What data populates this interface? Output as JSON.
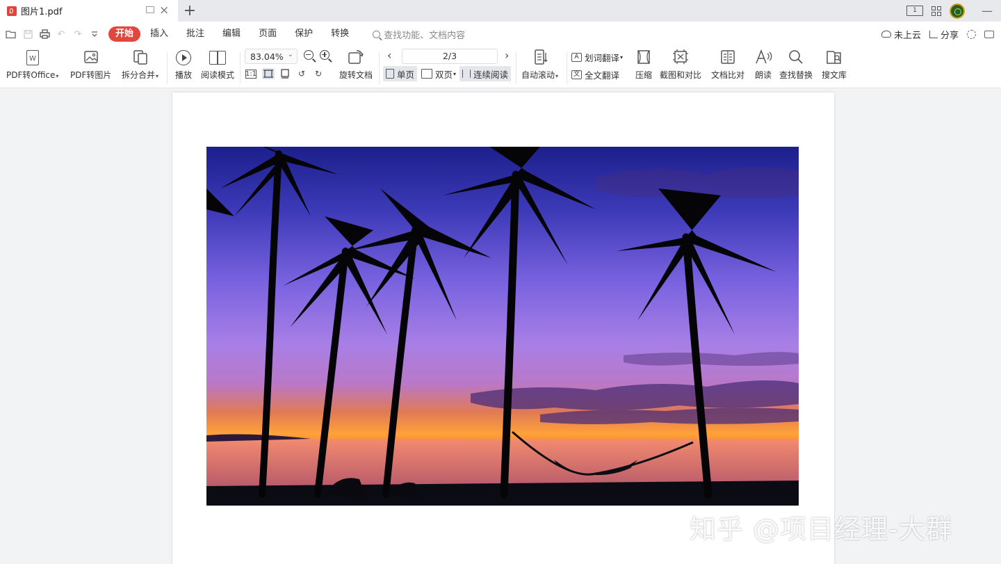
{
  "titlebar": {
    "tab_title": "图片1.pdf",
    "new_tab": "+",
    "read_mode_badge": "1",
    "minimize": "—"
  },
  "quick_access": {
    "icons": [
      "open-folder-icon",
      "save-icon",
      "print-icon",
      "undo-icon",
      "redo-icon",
      "customize-dropdown-icon"
    ]
  },
  "menu": {
    "items": [
      {
        "label": "开始",
        "active": true
      },
      {
        "label": "插入",
        "active": false
      },
      {
        "label": "批注",
        "active": false
      },
      {
        "label": "编辑",
        "active": false
      },
      {
        "label": "页面",
        "active": false
      },
      {
        "label": "保护",
        "active": false
      },
      {
        "label": "转换",
        "active": false
      }
    ],
    "search_placeholder": "查找功能、文档内容",
    "cloud_label": "未上云",
    "share_label": "分享"
  },
  "toolbar": {
    "pdf_to_office": "PDF转Office",
    "pdf_to_image": "PDF转图片",
    "split_merge": "拆分合并",
    "play": "播放",
    "read_mode": "阅读模式",
    "zoom_value": "83.04%",
    "actual_size": "1:1",
    "rotate_doc": "旋转文档",
    "page_indicator": "2/3",
    "prev_page": "‹",
    "next_page": "›",
    "single_page": "单页",
    "double_page": "双页",
    "continuous_read": "连续阅读",
    "auto_scroll": "自动滚动",
    "word_translate": "划词翻译",
    "full_translate": "全文翻译",
    "compress": "压缩",
    "screenshot_compare": "截图和对比",
    "doc_compare": "文档比对",
    "read_aloud": "朗读",
    "find_replace": "查找替换",
    "search_library": "搜文库"
  },
  "document": {
    "watermark": "知乎 @项目经理-大群"
  },
  "colors": {
    "accent_red": "#e3463d",
    "titlebar_bg": "#e8e9ec",
    "canvas_bg": "#f2f3f5"
  }
}
